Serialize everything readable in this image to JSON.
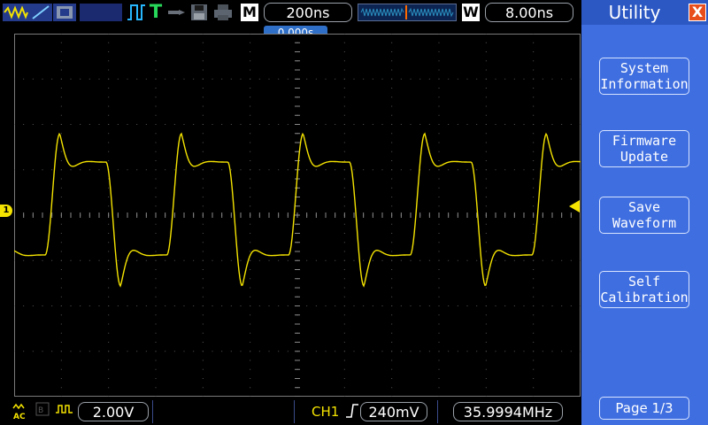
{
  "top_bar": {
    "run_state_glyph": "T",
    "memory_label": "M",
    "timebase": "200ns",
    "window_label": "W",
    "window_timebase": "8.00ns"
  },
  "trigger_position": "0.000s",
  "channel": {
    "marker": "1",
    "coupling": "AC",
    "volts_div": "2.00V",
    "color": "#f4e300"
  },
  "trigger": {
    "source": "CH1",
    "slope": "rising-edge-icon",
    "level": "240mV"
  },
  "frequency": "35.9994MHz",
  "menu": {
    "title": "Utility",
    "close_label": "X",
    "items": [
      {
        "line1": "System",
        "line2": "Information"
      },
      {
        "line1": "Firmware",
        "line2": "Update"
      },
      {
        "line1": "Save",
        "line2": "Waveform"
      },
      {
        "line1": "Self",
        "line2": "Calibration"
      }
    ],
    "page": "Page 1/3"
  },
  "colors": {
    "menu_bg": "#3f6ee0",
    "trace": "#f4e300",
    "accent": "#2f6fc8"
  }
}
